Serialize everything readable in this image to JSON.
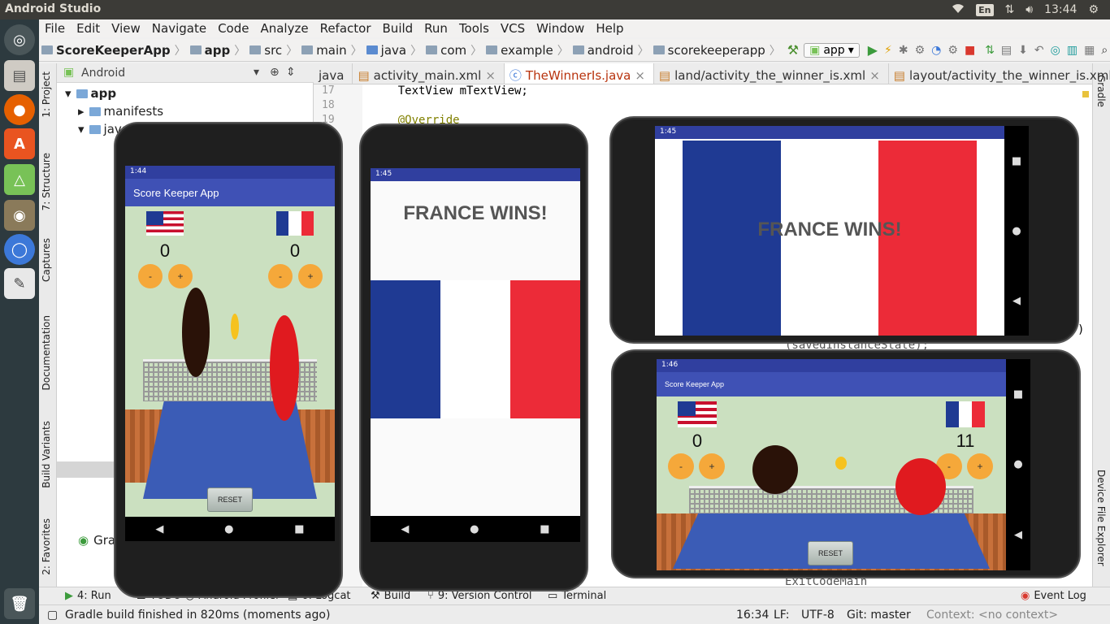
{
  "topbar": {
    "title": "Android Studio",
    "keyboard": "En",
    "time": "13:44"
  },
  "launcher": {
    "icons": [
      "dash-icon",
      "files-icon",
      "firefox-icon",
      "software-center-icon",
      "android-studio-icon",
      "gimp-icon",
      "chromium-icon",
      "text-editor-icon",
      "trash-icon"
    ]
  },
  "menu": [
    "File",
    "Edit",
    "View",
    "Navigate",
    "Code",
    "Analyze",
    "Refactor",
    "Build",
    "Run",
    "Tools",
    "VCS",
    "Window",
    "Help"
  ],
  "breadcrumbs": [
    "ScoreKeeperApp",
    "app",
    "src",
    "main",
    "java",
    "com",
    "example",
    "android",
    "scorekeeperapp"
  ],
  "run_config": "app",
  "left_tabs": [
    "1: Project",
    "7: Structure",
    "Captures",
    "Documentation",
    "Build Variants",
    "2: Favorites"
  ],
  "right_tabs": [
    "Gradle",
    "Device File Explorer"
  ],
  "project": {
    "view_mode": "Android",
    "tree": [
      {
        "label": "app",
        "level": 0
      },
      {
        "label": "manifests",
        "level": 1
      },
      {
        "label": "java",
        "level": 1
      },
      {
        "label": "Gradle Scripts",
        "level": 0
      }
    ]
  },
  "editor_tabs": [
    {
      "label": "java",
      "active": false
    },
    {
      "label": "activity_main.xml",
      "active": false
    },
    {
      "label": "TheWinnerIs.java",
      "active": true
    },
    {
      "label": "land/activity_the_winner_is.xml",
      "active": false
    },
    {
      "label": "layout/activity_the_winner_is.xml",
      "active": false
    }
  ],
  "code_lines": [
    {
      "num": "17",
      "text": "    TextView mTextView;"
    },
    {
      "num": "18",
      "text": ""
    },
    {
      "num": "19",
      "text": "    @Override"
    }
  ],
  "code_fragments": [
    ")",
    "(savedInstanceState);",
    "ExitCodeMain"
  ],
  "bottom_tabs": [
    "4: Run",
    "TODO",
    "Android Profiler",
    "6: Logcat",
    "Build",
    "9: Version Control",
    "Terminal",
    "Event Log"
  ],
  "status": {
    "message": "Gradle build finished in 820ms (moments ago)",
    "position": "16:34",
    "line_sep": "LF:",
    "encoding": "UTF-8",
    "vcs": "Git: master",
    "context": "Context: <no context>"
  },
  "phone1": {
    "time": "1:44",
    "app_title": "Score Keeper App",
    "score_left": "0",
    "score_right": "0",
    "minus": "-",
    "plus": "+",
    "reset": "RESET"
  },
  "phone2": {
    "time": "1:45",
    "headline": "FRANCE WINS!"
  },
  "phone3": {
    "time": "1:45",
    "headline": "FRANCE WINS!"
  },
  "phone4": {
    "time": "1:46",
    "app_title": "Score Keeper App",
    "score_left": "0",
    "score_right": "11",
    "minus": "-",
    "plus": "+",
    "reset": "RESET"
  },
  "colors": {
    "app_bar": "#3f51b5",
    "status_bar": "#303f9f",
    "score_button": "#f5a83a",
    "france_blue": "#1f3a93",
    "france_red": "#ec2b38"
  }
}
